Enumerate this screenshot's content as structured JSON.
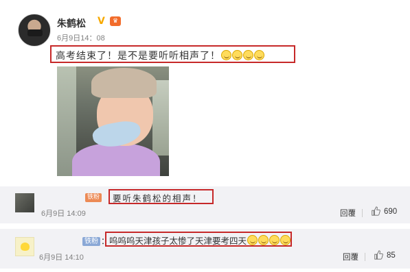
{
  "post": {
    "username": "朱鹤松",
    "verified_symbol": "V",
    "timestamp": "6月9日14：08",
    "text": "高考结束了！是不是要听听相声了！",
    "emoji_count_icons": [
      "grin-emoji",
      "grin-emoji",
      "grin-emoji",
      "grin-emoji"
    ]
  },
  "comments": [
    {
      "badge": "铁粉",
      "colon": "：",
      "text": "要听朱鹤松的相声！",
      "time": "6月9日 14:09",
      "reply_label": "回覆",
      "likes": "690"
    },
    {
      "badge": "铁粉",
      "colon": "：",
      "text": "呜呜呜天津孩子太惨了天津要考四天",
      "time": "6月9日 14:10",
      "reply_label": "回覆",
      "likes": "85"
    }
  ],
  "colors": {
    "highlight_border": "#c62828",
    "verified": "#f7a900",
    "comment_bg": "#f2f2f5"
  }
}
